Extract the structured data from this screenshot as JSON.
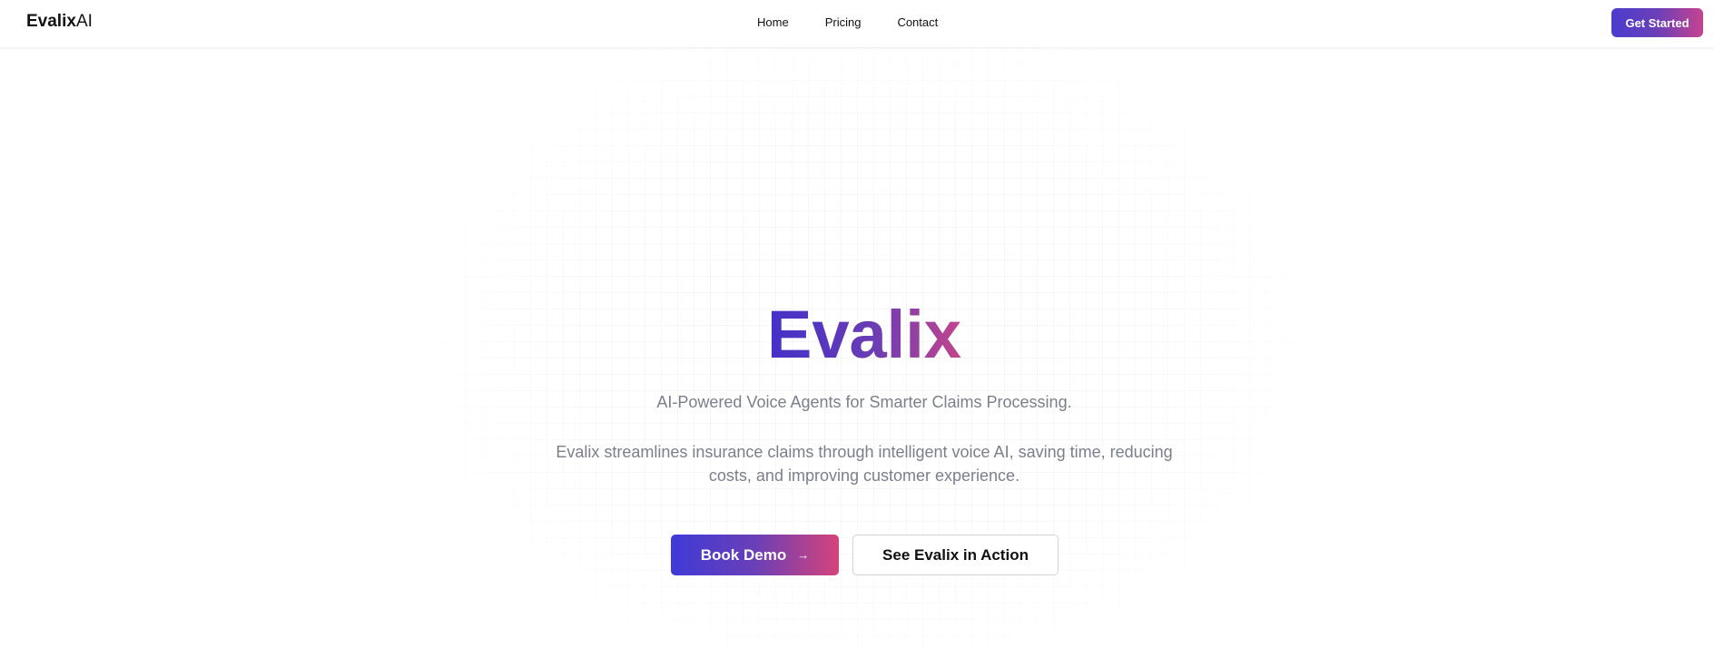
{
  "navbar": {
    "logo": {
      "bold": "Evalix",
      "light": "AI"
    },
    "links": [
      {
        "label": "Home"
      },
      {
        "label": "Pricing"
      },
      {
        "label": "Contact"
      }
    ],
    "cta_label": "Get Started"
  },
  "hero": {
    "title": "Evalix",
    "subtitle": "AI-Powered Voice Agents for Smarter Claims Processing.",
    "description": "Evalix streamlines insurance claims through intelligent voice AI, saving time, reducing costs, and improving customer experience.",
    "primary_button": {
      "label": "Book Demo",
      "icon": "arrow-right-icon",
      "icon_glyph": "→"
    },
    "secondary_button": {
      "label": "See Evalix in Action"
    }
  },
  "colors": {
    "gradient_start": "#4330c9",
    "gradient_mid": "#6a3db4",
    "gradient_end": "#c4448c",
    "muted_text": "#7b7f8a"
  }
}
